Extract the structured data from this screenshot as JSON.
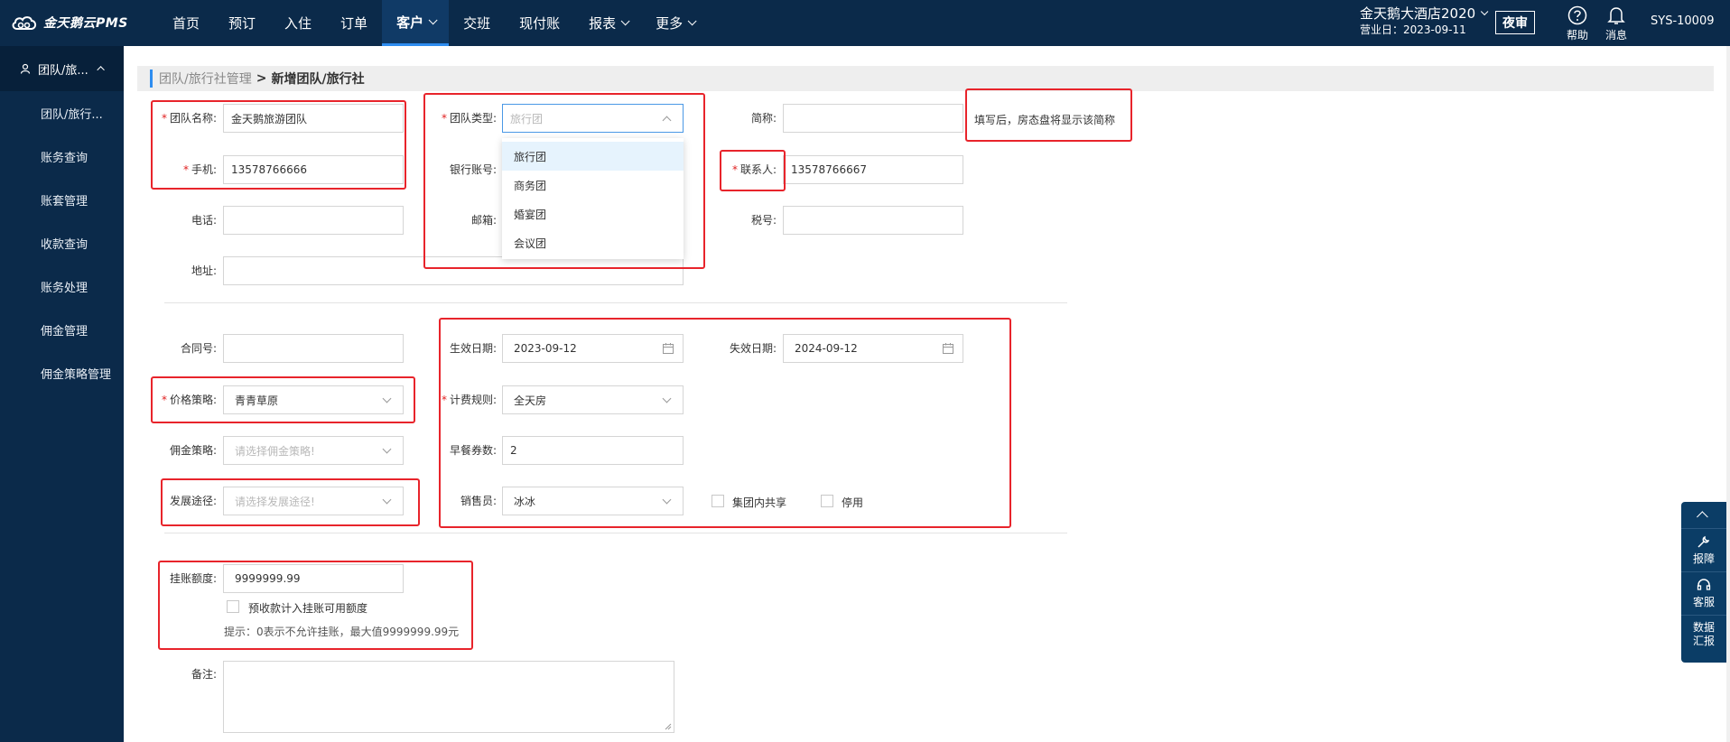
{
  "app": {
    "logo_text": "金天鹅云PMS",
    "nav": [
      {
        "label": "首页",
        "has_caret": false,
        "active": false
      },
      {
        "label": "预订",
        "has_caret": false,
        "active": false
      },
      {
        "label": "入住",
        "has_caret": false,
        "active": false
      },
      {
        "label": "订单",
        "has_caret": false,
        "active": false
      },
      {
        "label": "客户",
        "has_caret": true,
        "active": true
      },
      {
        "label": "交班",
        "has_caret": false,
        "active": false
      },
      {
        "label": "现付账",
        "has_caret": false,
        "active": false
      },
      {
        "label": "报表",
        "has_caret": true,
        "active": false
      },
      {
        "label": "更多",
        "has_caret": true,
        "active": false
      }
    ],
    "hotel_name": "金天鹅大酒店2020",
    "business_date": "营业日：2023-09-11",
    "night_audit": "夜审",
    "help_label": "帮助",
    "message_label": "消息",
    "user": "SYS-10009"
  },
  "sidebar": {
    "head": "团队/旅...",
    "items": [
      "团队/旅行...",
      "账务查询",
      "账套管理",
      "收款查询",
      "账务处理",
      "佣金管理",
      "佣金策略管理"
    ]
  },
  "breadcrumb": {
    "link": "团队/旅行社管理",
    "separator": ">",
    "current": "新增团队/旅行社"
  },
  "form": {
    "team_name": {
      "label": "团队名称:",
      "value": "金天鹅旅游团队"
    },
    "mobile": {
      "label": "手机:",
      "value": "13578766666"
    },
    "phone": {
      "label": "电话:",
      "value": ""
    },
    "address": {
      "label": "地址:",
      "value": ""
    },
    "team_type": {
      "label": "团队类型:",
      "placeholder": "旅行团",
      "options": [
        "旅行团",
        "商务团",
        "婚宴团",
        "会议团"
      ]
    },
    "bank_account": {
      "label": "银行账号:"
    },
    "email": {
      "label": "邮箱:"
    },
    "short_name": {
      "label": "简称:",
      "value": "",
      "hint": "填写后，房态盘将显示该简称"
    },
    "contact": {
      "label": "联系人:",
      "value": "13578766667"
    },
    "tax_no": {
      "label": "税号:",
      "value": ""
    },
    "contract_no": {
      "label": "合同号:",
      "value": ""
    },
    "price_policy": {
      "label": "价格策略:",
      "value": "青青草原"
    },
    "commission_policy": {
      "label": "佣金策略:",
      "placeholder": "请选择佣金策略!"
    },
    "dev_channel": {
      "label": "发展途径:",
      "placeholder": "请选择发展途径!"
    },
    "effective_date": {
      "label": "生效日期:",
      "value": "2023-09-12"
    },
    "expire_date": {
      "label": "失效日期:",
      "value": "2024-09-12"
    },
    "billing_rule": {
      "label": "计费规则:",
      "value": "全天房"
    },
    "breakfast_count": {
      "label": "早餐券数:",
      "value": "2"
    },
    "salesperson": {
      "label": "销售员:",
      "value": "冰冰"
    },
    "group_share": {
      "label": "集团内共享"
    },
    "disabled": {
      "label": "停用"
    },
    "credit_limit": {
      "label": "挂账额度:",
      "value": "9999999.99"
    },
    "prepay_included": {
      "label": "预收款计入挂账可用额度"
    },
    "credit_tip": "提示：0表示不允许挂账，最大值9999999.99元",
    "remark": {
      "label": "备注:"
    }
  },
  "float_panel": {
    "report_fault": "报障",
    "service": "客服",
    "data_report_line1": "数据",
    "data_report_line2": "汇报"
  }
}
